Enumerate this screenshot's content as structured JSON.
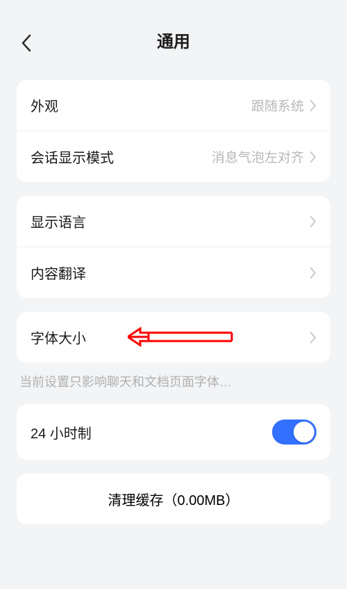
{
  "header": {
    "title": "通用"
  },
  "group1": {
    "appearance": {
      "label": "外观",
      "value": "跟随系统"
    },
    "chatDisplay": {
      "label": "会话显示模式",
      "value": "消息气泡左对齐"
    }
  },
  "group2": {
    "language": {
      "label": "显示语言"
    },
    "translation": {
      "label": "内容翻译"
    }
  },
  "group3": {
    "fontSize": {
      "label": "字体大小"
    },
    "hint": "当前设置只影响聊天和文档页面字体…"
  },
  "group4": {
    "clock24h": {
      "label": "24 小时制"
    }
  },
  "group5": {
    "clearCache": {
      "label": "清理缓存（0.00MB）"
    }
  }
}
